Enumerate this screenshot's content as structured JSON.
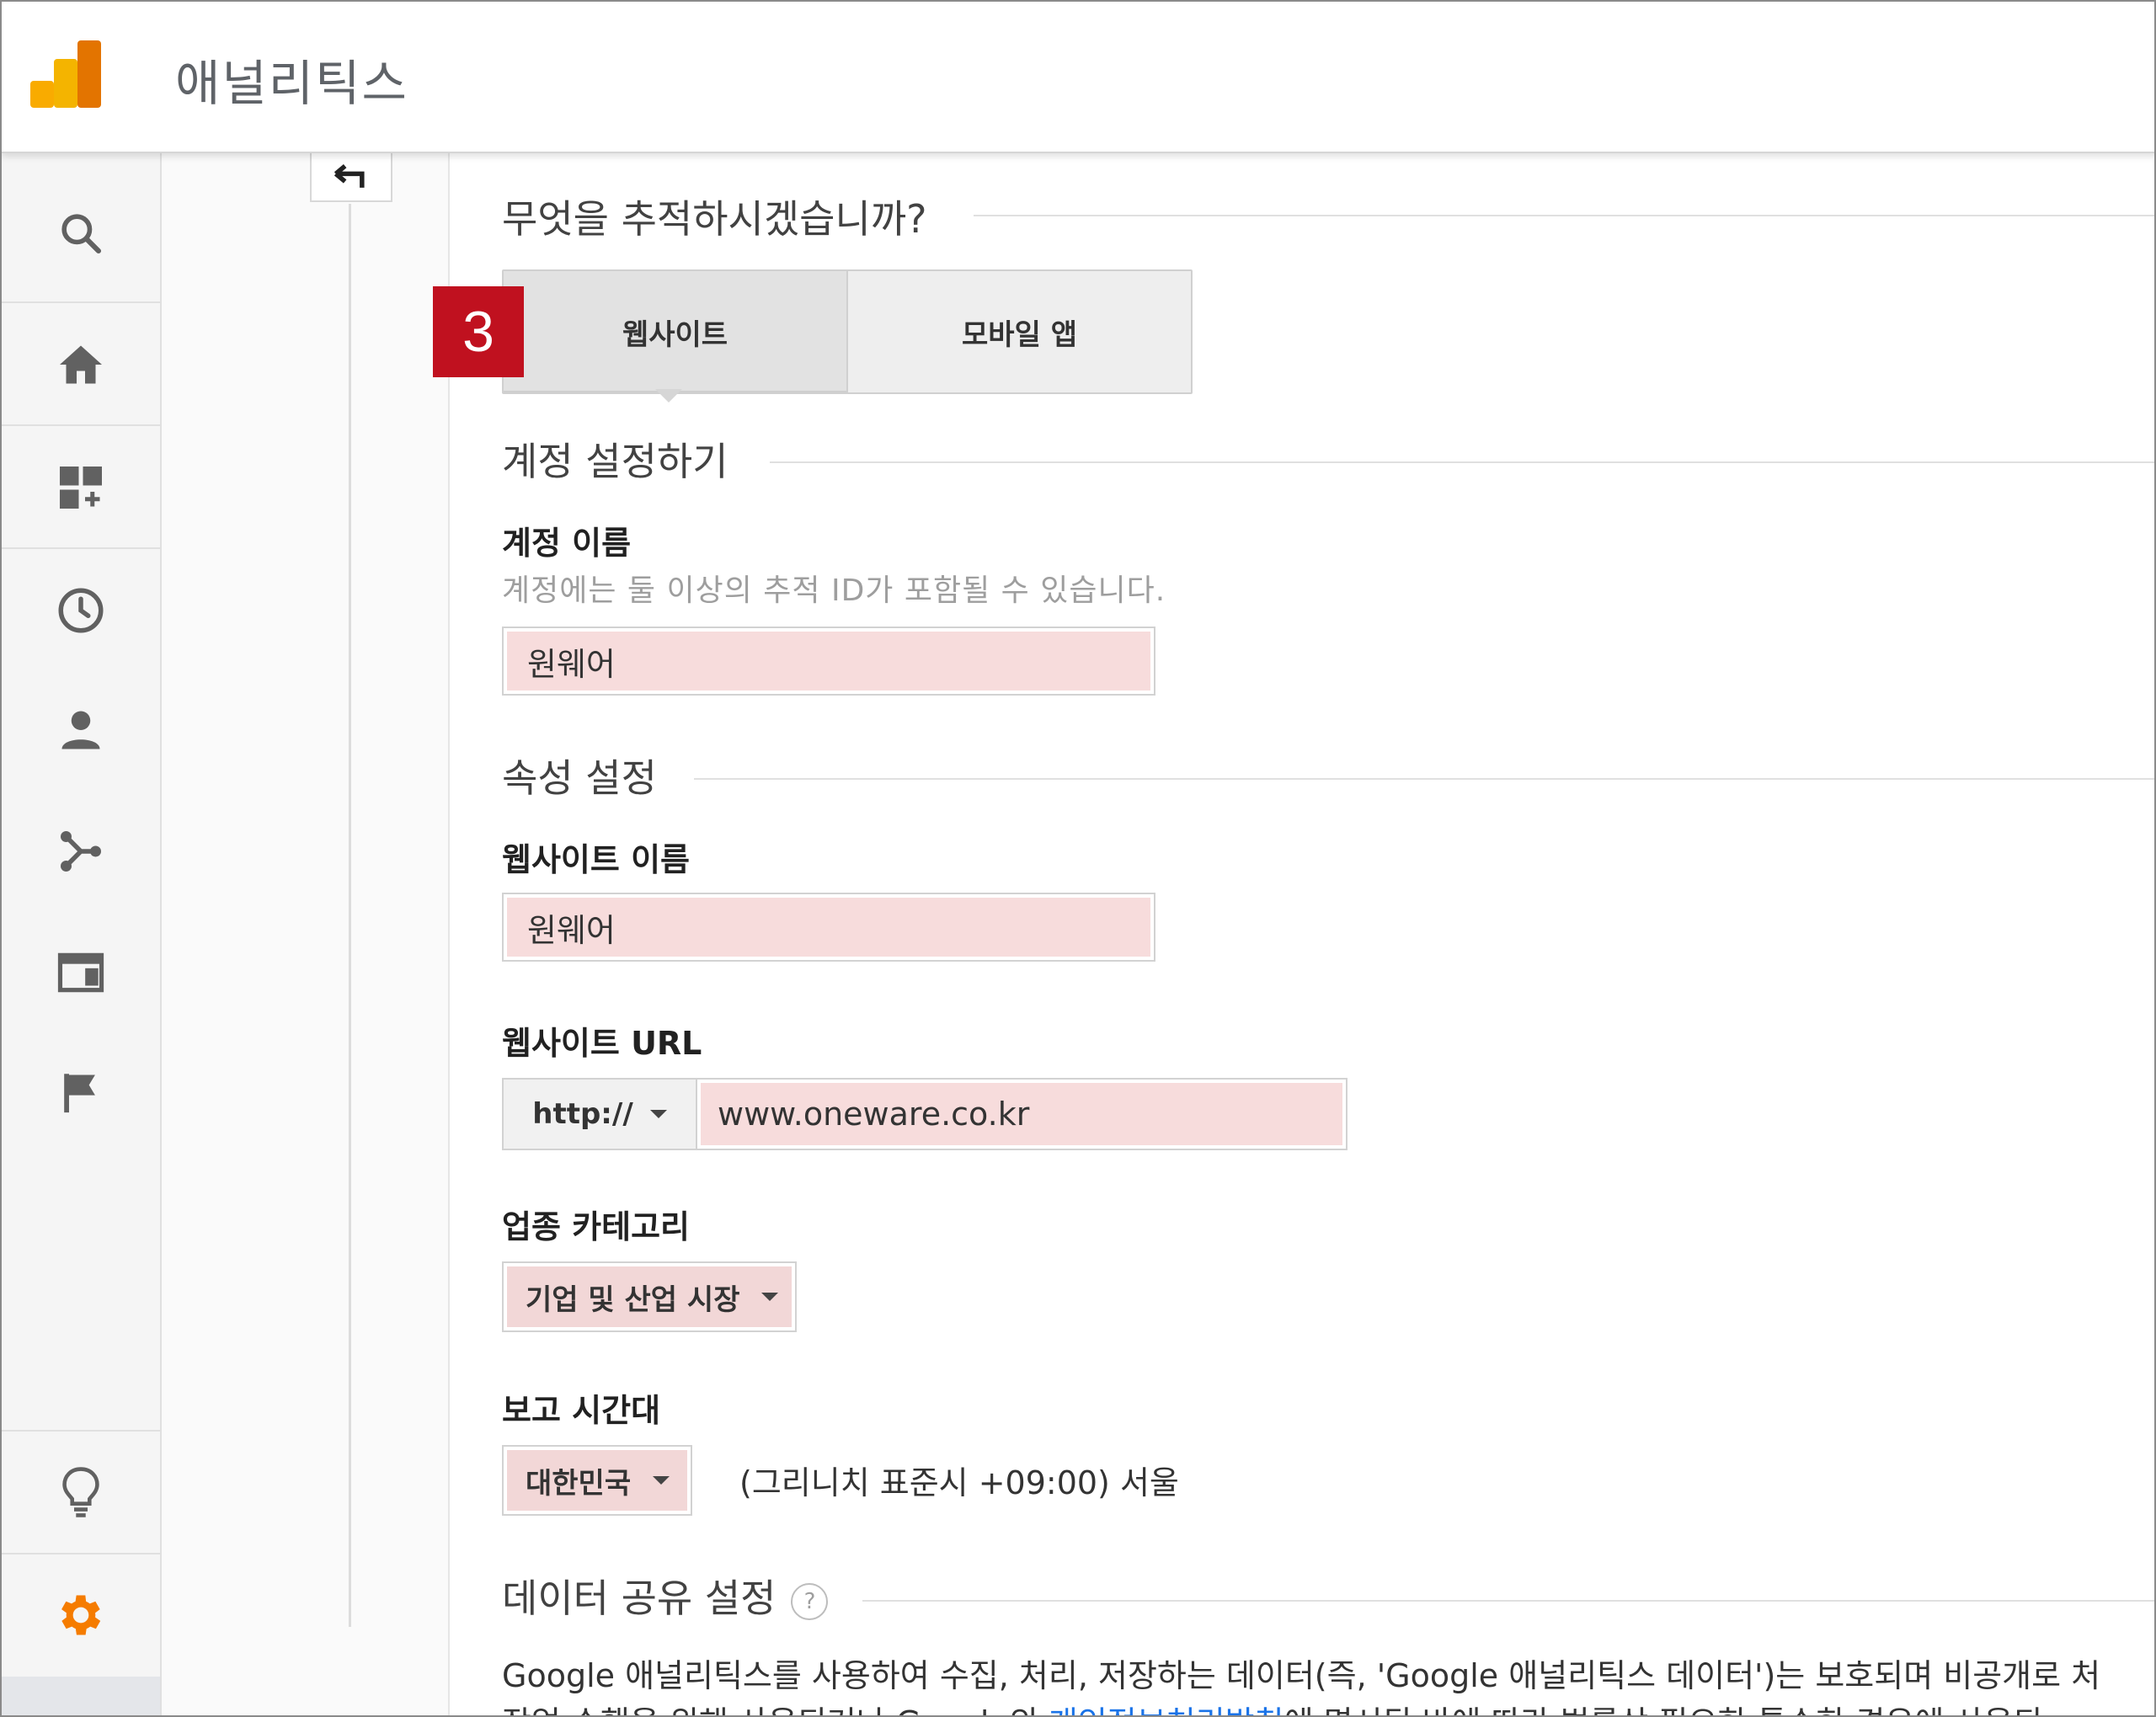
{
  "app": {
    "title": "애널리틱스"
  },
  "colors": {
    "accent_orange": "#f57c00",
    "badge_red": "#c0111f",
    "highlight_pink": "#f7dcdc",
    "link_blue": "#1a73e8"
  },
  "nav": {
    "items": [
      "search-icon",
      "home-icon",
      "customization-icon",
      "realtime-clock-icon",
      "audience-person-icon",
      "acquisition-icon",
      "behavior-icon",
      "conversions-flag-icon"
    ],
    "bottom": [
      "lightbulb-icon",
      "admin-gear-icon"
    ]
  },
  "form": {
    "track_question": "무엇을 추적하시겠습니까?",
    "step_badge": "3",
    "track_options": {
      "website": "웹사이트",
      "mobile_app": "모바일 앱"
    },
    "account_section": "계정 설정하기",
    "account_name_label": "계정 이름",
    "account_name_hint": "계정에는 둘 이상의 추적 ID가 포함될 수 있습니다.",
    "account_name_value": "원웨어",
    "property_section": "속성 설정",
    "website_name_label": "웹사이트 이름",
    "website_name_value": "원웨어",
    "website_url_label": "웹사이트 URL",
    "url_protocol": "http://",
    "url_value": "www.oneware.co.kr",
    "industry_label": "업종 카테고리",
    "industry_value": "기업 및 산업 시장",
    "timezone_label": "보고 시간대",
    "timezone_country": "대한민국",
    "timezone_text": "(그리니치 표준시 +09:00) 서울",
    "data_sharing_section": "데이터 공유 설정",
    "data_sharing_help": "?",
    "data_sharing_line1": "Google 애널리틱스를 사용하여 수집, 처리, 저장하는 데이터(즉, 'Google 애널리틱스 데이터')는 보호되며 비공개로 처",
    "data_sharing_line2_pre": "작업 수행을 위해 사용되거나 Google의 ",
    "data_sharing_link": "개인정보처리방침",
    "data_sharing_line2_post": "에 명시된 바에 따라 법률상 필요한 특수한 경우에 사용되"
  }
}
